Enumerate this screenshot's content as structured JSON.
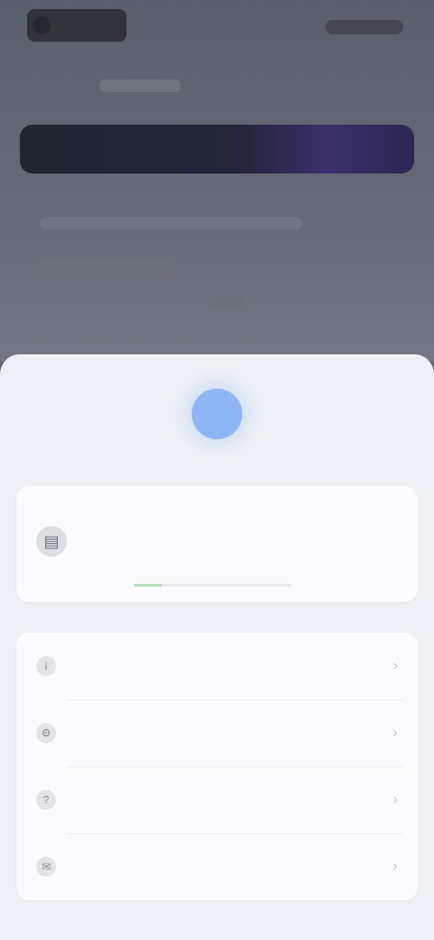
{
  "background": {
    "colors": {
      "banner_start": "#20252f",
      "banner_end": "#3b2f6b"
    }
  },
  "sheet": {
    "section_label": "",
    "featured": {
      "icon": "document-icon",
      "title": "",
      "meta": "",
      "progress": 0.18,
      "progress_color": "#b8dcbc"
    },
    "items": [
      {
        "icon": "info-icon",
        "label": ""
      },
      {
        "icon": "settings-icon",
        "label": ""
      },
      {
        "icon": "help-icon",
        "label": ""
      },
      {
        "icon": "feedback-icon",
        "label": ""
      }
    ],
    "accent_color": "#8fb6f4"
  }
}
